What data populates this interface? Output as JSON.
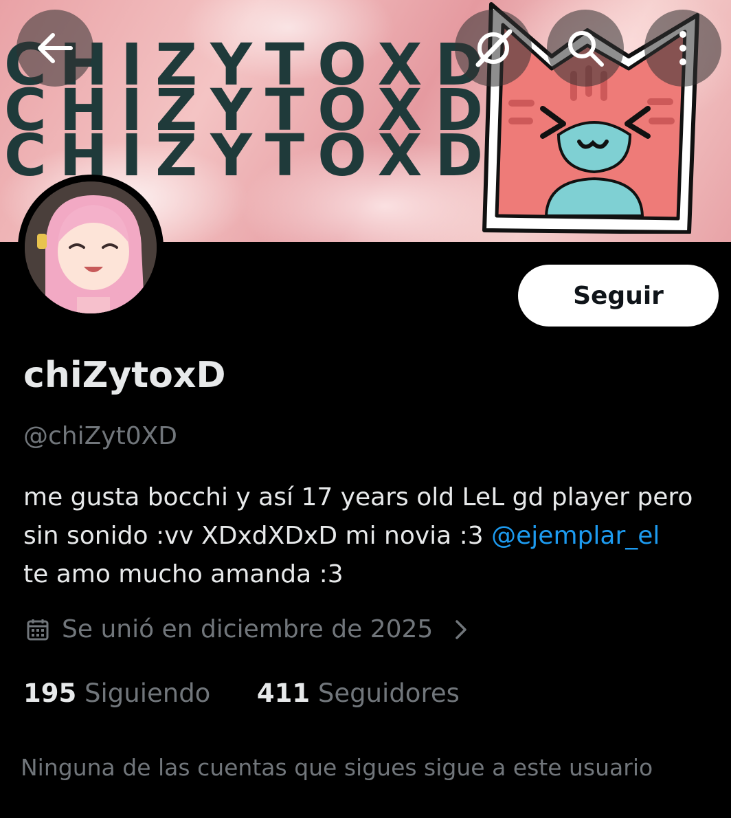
{
  "header": {
    "banner_text": "CHIZYTOXD",
    "back_icon": "back-arrow-icon",
    "translate_icon": "grok-icon",
    "search_icon": "search-icon",
    "more_icon": "more-vertical-icon"
  },
  "profile": {
    "display_name": "chiZytoxD",
    "handle": "@chiZyt0XD",
    "bio_line1": "me gusta bocchi y así 17 years old LeL gd player pero",
    "bio_line2": "sin sonido :vv XDxdXDxD mi novia :3 ",
    "bio_mention": "@ejemplar_el",
    "bio_line3": "te amo mucho amanda :3",
    "joined": "Se unió en diciembre de 2025",
    "following_count": "195",
    "following_label": "Siguiendo",
    "followers_count": "411",
    "followers_label": "Seguidores",
    "mutuals_text": "Ninguna de las cuentas que sigues sigue a este usuario"
  },
  "actions": {
    "follow_label": "Seguir"
  },
  "colors": {
    "background": "#000000",
    "text_primary": "#e7e9ea",
    "text_secondary": "#71767b",
    "link": "#1d9bf0",
    "banner_pink": "#ec9ea4",
    "banner_text": "#1f3a3a"
  }
}
